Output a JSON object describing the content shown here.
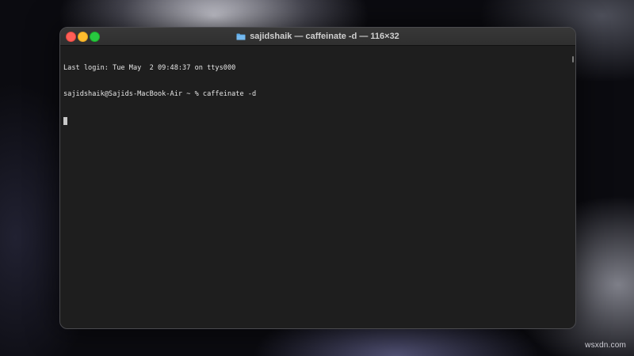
{
  "window": {
    "title": "sajidshaik — caffeinate -d — 116×32",
    "title_icon": "folder-icon",
    "traffic_lights": {
      "close_color": "#ff5f57",
      "minimize_color": "#febc2e",
      "zoom_color": "#28c840"
    }
  },
  "terminal": {
    "lines": [
      "Last login: Tue May  2 09:48:37 on ttys000",
      "sajidshaik@Sajids-MacBook-Air ~ % caffeinate -d"
    ],
    "background_color": "#1e1e1e",
    "text_color": "#e6e6e6"
  },
  "watermark": {
    "text": "wsxdn.com"
  }
}
